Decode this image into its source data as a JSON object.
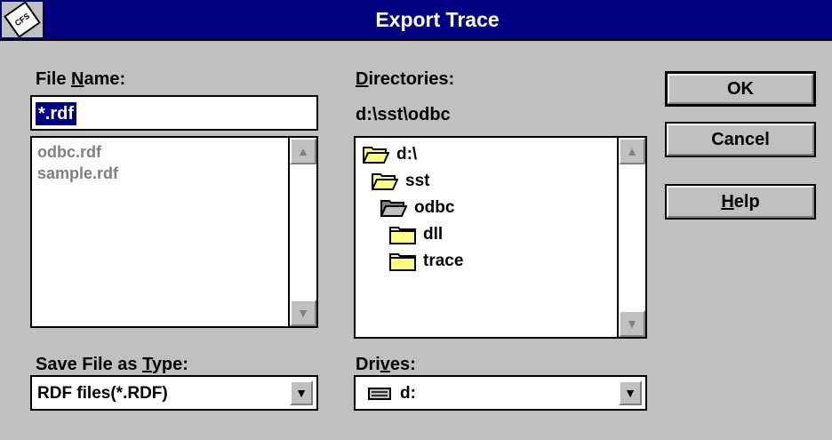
{
  "window": {
    "title": "Export Trace",
    "system_menu_icon": "cfs-logo-icon"
  },
  "file_name": {
    "label_prefix": "File ",
    "label_accel": "N",
    "label_suffix": "ame:",
    "value": "*.rdf",
    "files": [
      "odbc.rdf",
      "sample.rdf"
    ]
  },
  "directories": {
    "label_accel": "D",
    "label_suffix": "irectories:",
    "current_path": "d:\\sst\\odbc",
    "items": [
      {
        "name": "d:\\",
        "icon": "open-folder-icon"
      },
      {
        "name": "sst",
        "icon": "open-folder-icon"
      },
      {
        "name": "odbc",
        "icon": "open-folder-selected-icon"
      },
      {
        "name": "dll",
        "icon": "closed-folder-icon"
      },
      {
        "name": "trace",
        "icon": "closed-folder-icon"
      }
    ]
  },
  "save_type": {
    "label_prefix": "Save File as ",
    "label_accel": "T",
    "label_suffix": "ype:",
    "value": "RDF files(*.RDF)"
  },
  "drives": {
    "label_prefix": "Dri",
    "label_accel": "v",
    "label_suffix": "es:",
    "value": "d:",
    "icon": "drive-icon"
  },
  "buttons": {
    "ok": "OK",
    "cancel": "Cancel",
    "help_accel": "H",
    "help_suffix": "elp"
  },
  "colors": {
    "titlebar": "#000080",
    "face": "#c0c0c0",
    "selection": "#000080",
    "disabled_text": "#808080"
  }
}
